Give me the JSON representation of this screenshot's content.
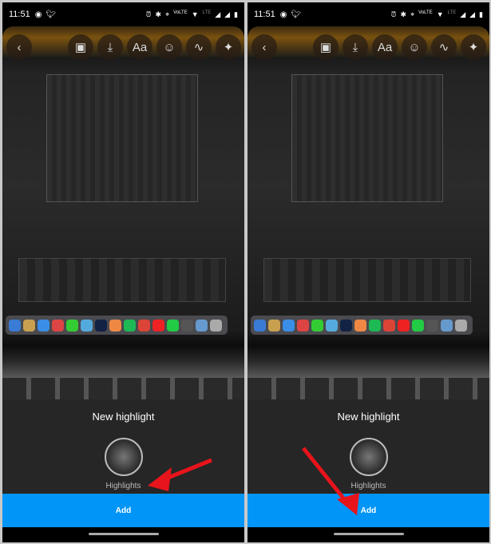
{
  "status_bar": {
    "time": "11:51",
    "left_icons": [
      "messenger-icon",
      "twitter-icon"
    ],
    "right_icons": [
      "alarm-icon",
      "bluetooth-icon",
      "location-icon",
      "volte-icon",
      "wifi-icon",
      "signal-icon",
      "signal-icon",
      "battery-icon"
    ],
    "lte": "LTE",
    "volte": "VoLTE"
  },
  "toolbar": {
    "icons": [
      "back-icon",
      "profile-frame-icon",
      "download-icon",
      "text-icon",
      "sticker-icon",
      "draw-icon",
      "effects-icon"
    ],
    "text_label": "Aa"
  },
  "sheet": {
    "title": "New highlight",
    "highlight_name": "Highlights",
    "add_label": "Add"
  },
  "colors": {
    "accent": "#0095f6",
    "sheet_bg": "#262626",
    "arrow": "#e8141b"
  }
}
